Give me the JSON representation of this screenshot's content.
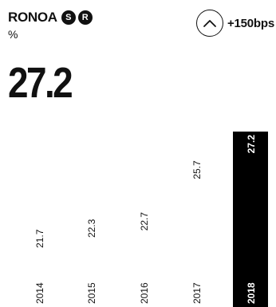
{
  "header": {
    "metric_name": "RONOA",
    "badge_s": "S",
    "badge_r": "R",
    "unit": "%",
    "change_icon": "chevron-up-icon",
    "change_text": "+150bps"
  },
  "big_value": "27.2",
  "colors": {
    "text": "#111111",
    "highlight_bar": "#000000",
    "highlight_text": "#ffffff"
  },
  "chart_data": {
    "type": "bar",
    "categories": [
      "2014",
      "2015",
      "2016",
      "2017",
      "2018"
    ],
    "values": [
      21.7,
      22.3,
      22.7,
      25.7,
      27.2
    ],
    "value_labels": [
      "21.7",
      "22.3",
      "22.7",
      "25.7",
      "27.2"
    ],
    "highlight_index": 4,
    "title": "",
    "xlabel": "",
    "ylabel": "",
    "ylim": [
      0,
      27.2
    ],
    "grid": false,
    "legend": "none"
  }
}
